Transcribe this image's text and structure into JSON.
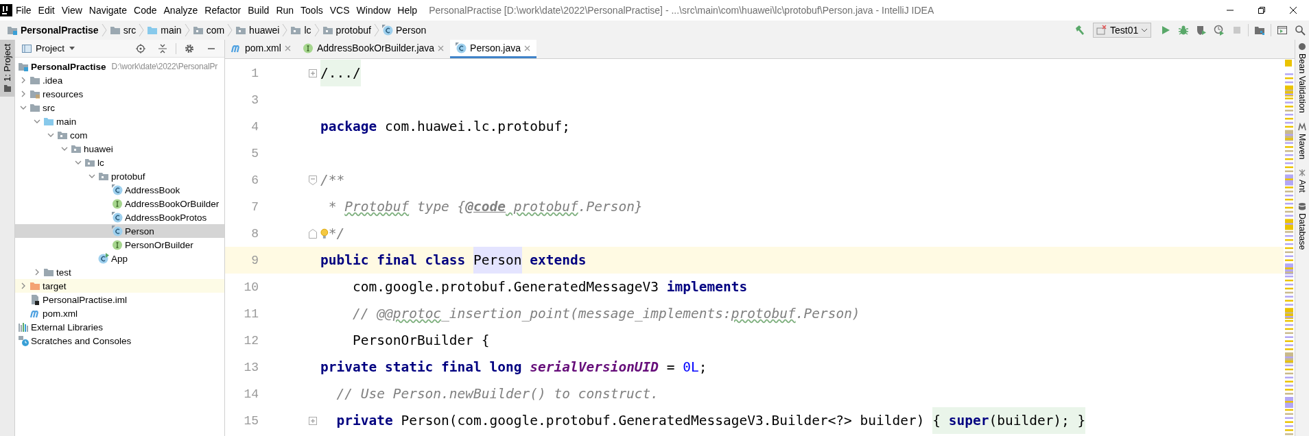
{
  "window": {
    "title": "PersonalPractise [D:\\work\\date\\2022\\PersonalPractise] - ...\\src\\main\\com\\huawei\\lc\\protobuf\\Person.java - IntelliJ IDEA"
  },
  "menu": [
    "File",
    "Edit",
    "View",
    "Navigate",
    "Code",
    "Analyze",
    "Refactor",
    "Build",
    "Run",
    "Tools",
    "VCS",
    "Window",
    "Help"
  ],
  "breadcrumbs": [
    {
      "label": "PersonalPractise",
      "kind": "project"
    },
    {
      "label": "src",
      "kind": "folder"
    },
    {
      "label": "main",
      "kind": "source"
    },
    {
      "label": "com",
      "kind": "package"
    },
    {
      "label": "huawei",
      "kind": "package"
    },
    {
      "label": "lc",
      "kind": "package"
    },
    {
      "label": "protobuf",
      "kind": "package"
    },
    {
      "label": "Person",
      "kind": "class"
    }
  ],
  "run_config": {
    "label": "Test01"
  },
  "left_strip": {
    "label": "1: Project"
  },
  "project_panel": {
    "title": "Project",
    "tree": [
      {
        "label": "PersonalPractise",
        "path": "D:\\work\\date\\2022\\PersonalPr",
        "kind": "project",
        "selected": false,
        "children": [
          {
            "label": ".idea",
            "kind": "folder",
            "expanded": false,
            "selected": false
          },
          {
            "label": "resources",
            "kind": "resources",
            "expanded": false,
            "selected": false
          },
          {
            "label": "src",
            "kind": "folder",
            "expanded": true,
            "selected": false,
            "children": [
              {
                "label": "main",
                "kind": "source",
                "expanded": true,
                "selected": false,
                "children": [
                  {
                    "label": "com",
                    "kind": "package",
                    "expanded": true,
                    "selected": false,
                    "children": [
                      {
                        "label": "huawei",
                        "kind": "package",
                        "expanded": true,
                        "selected": false,
                        "children": [
                          {
                            "label": "lc",
                            "kind": "package",
                            "expanded": true,
                            "selected": false,
                            "children": [
                              {
                                "label": "protobuf",
                                "kind": "package",
                                "expanded": true,
                                "selected": false,
                                "children": [
                                  {
                                    "label": "AddressBook",
                                    "kind": "class",
                                    "selected": false
                                  },
                                  {
                                    "label": "AddressBookOrBuilder",
                                    "kind": "interface",
                                    "selected": false
                                  },
                                  {
                                    "label": "AddressBookProtos",
                                    "kind": "class",
                                    "selected": false
                                  },
                                  {
                                    "label": "Person",
                                    "kind": "class",
                                    "selected": true
                                  },
                                  {
                                    "label": "PersonOrBuilder",
                                    "kind": "interface",
                                    "selected": false
                                  }
                                ]
                              },
                              {
                                "label": "App",
                                "kind": "app",
                                "selected": false
                              }
                            ]
                          }
                        ]
                      }
                    ]
                  }
                ]
              },
              {
                "label": "test",
                "kind": "folder",
                "expanded": false,
                "selected": false
              }
            ]
          },
          {
            "label": "target",
            "kind": "excluded",
            "expanded": false,
            "selected": false
          },
          {
            "label": "PersonalPractise.iml",
            "kind": "iml",
            "selected": false
          },
          {
            "label": "pom.xml",
            "kind": "maven",
            "selected": false
          }
        ]
      },
      {
        "label": "External Libraries",
        "kind": "libraries",
        "selected": false
      },
      {
        "label": "Scratches and Consoles",
        "kind": "scratches",
        "selected": false
      }
    ]
  },
  "tabs": [
    {
      "label": "pom.xml",
      "kind": "maven",
      "selected": false
    },
    {
      "label": "AddressBookOrBuilder.java",
      "kind": "interface",
      "selected": false
    },
    {
      "label": "Person.java",
      "kind": "class",
      "selected": true
    }
  ],
  "editor": {
    "lines": [
      {
        "number": "1",
        "current": false,
        "fold": {
          "kind": "collapsed"
        },
        "tokens": [
          {
            "text": "/.../",
            "kind": "folded"
          }
        ]
      },
      {
        "number": "3",
        "current": false
      },
      {
        "number": "4",
        "current": false,
        "tokens": [
          {
            "text": "package",
            "kind": "keyword"
          },
          {
            "text": " com.huawei.lc.protobuf;",
            "kind": "plain"
          }
        ]
      },
      {
        "number": "5",
        "current": false
      },
      {
        "number": "6",
        "current": false,
        "fold": {
          "kind": "start"
        },
        "tokens": [
          {
            "text": "/**",
            "kind": "doc"
          }
        ]
      },
      {
        "number": "7",
        "current": false,
        "tokens": [
          {
            "text": " * ",
            "kind": "doc"
          },
          {
            "text": "Protobuf",
            "kind": "doc-typo"
          },
          {
            "text": " type {",
            "kind": "doc"
          },
          {
            "text": "@code",
            "kind": "doc-tag"
          },
          {
            "text": " protobuf",
            "kind": "doc-typo"
          },
          {
            "text": ".Person}",
            "kind": "doc"
          }
        ]
      },
      {
        "number": "8",
        "current": false,
        "fold": {
          "kind": "end"
        },
        "gutter_icon": {
          "kind": "bulb"
        },
        "tokens": [
          {
            "text": "*/",
            "kind": "doc"
          }
        ]
      },
      {
        "number": "9",
        "current": true,
        "tokens": [
          {
            "text": "public final class ",
            "kind": "keyword"
          },
          {
            "text": "Person",
            "kind": "usage"
          },
          {
            "text": " extends",
            "kind": "keyword"
          }
        ]
      },
      {
        "number": "10",
        "current": false,
        "tokens": [
          {
            "text": "    com.google.protobuf.GeneratedMessageV3 ",
            "kind": "plain"
          },
          {
            "text": "implements",
            "kind": "keyword"
          }
        ]
      },
      {
        "number": "11",
        "current": false,
        "tokens": [
          {
            "text": "    // @@",
            "kind": "comment"
          },
          {
            "text": "protoc",
            "kind": "comment-typo"
          },
          {
            "text": "_insertion_point(message_implements:",
            "kind": "comment"
          },
          {
            "text": "protobuf",
            "kind": "comment-typo"
          },
          {
            "text": ".Person)",
            "kind": "comment"
          }
        ]
      },
      {
        "number": "12",
        "current": false,
        "tokens": [
          {
            "text": "    PersonOrBuilder {",
            "kind": "plain"
          }
        ]
      },
      {
        "number": "13",
        "current": false,
        "tokens": [
          {
            "text": "private static final long ",
            "kind": "keyword"
          },
          {
            "text": "serialVersionUID",
            "kind": "field"
          },
          {
            "text": " = ",
            "kind": "plain"
          },
          {
            "text": "0L",
            "kind": "number"
          },
          {
            "text": ";",
            "kind": "plain"
          }
        ]
      },
      {
        "number": "14",
        "current": false,
        "tokens": [
          {
            "text": "  // Use Person.newBuilder() to construct.",
            "kind": "comment"
          }
        ]
      },
      {
        "number": "15",
        "current": false,
        "fold": {
          "kind": "collapsed"
        },
        "tokens": [
          {
            "text": "  private",
            "kind": "keyword"
          },
          {
            "text": " Person(com.google.protobuf.GeneratedMessageV3.Builder<?> builder) ",
            "kind": "plain"
          },
          {
            "text": "{ ",
            "kind": "folded"
          },
          {
            "text": "super",
            "kind": "folded-keyword"
          },
          {
            "text": "(builder); }",
            "kind": "folded"
          }
        ]
      }
    ]
  },
  "right_strip": [
    "Bean Validation",
    "Maven",
    "Ant",
    "Database"
  ]
}
